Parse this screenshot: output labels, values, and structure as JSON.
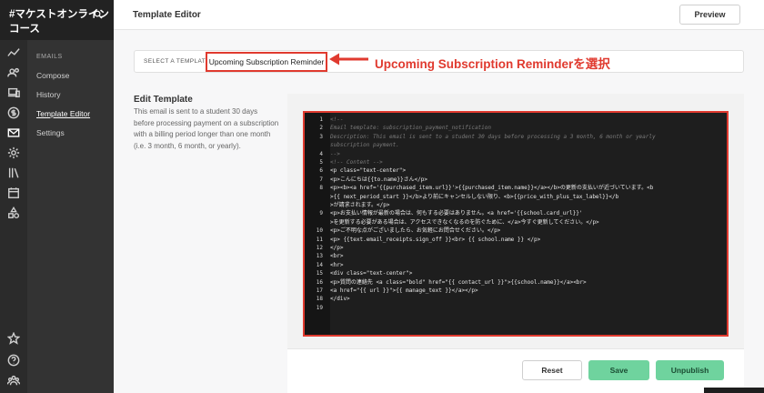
{
  "brand": {
    "name_line1": "#マケストオンライン",
    "name_line2": "コース"
  },
  "sidebar": {
    "section": "EMAILS",
    "items": [
      {
        "label": "Compose",
        "active": false
      },
      {
        "label": "History",
        "active": false
      },
      {
        "label": "Template Editor",
        "active": true
      },
      {
        "label": "Settings",
        "active": false
      }
    ]
  },
  "rail_icons": [
    "chart-icon",
    "users-icon",
    "devices-icon",
    "dollar-icon",
    "mail-icon",
    "settings-icon",
    "library-icon",
    "calendar-icon",
    "shapes-icon",
    "star-icon",
    "help-icon",
    "community-icon"
  ],
  "header": {
    "title": "Template Editor",
    "preview_label": "Preview"
  },
  "selector": {
    "label": "SELECT A TEMPLATE",
    "value": "Upcoming Subscription Reminder"
  },
  "annotation": {
    "callout": "Upcoming Subscription Reminderを選択",
    "color": "#e03a2f"
  },
  "edit": {
    "heading": "Edit Template",
    "description": "This email is sent to a student 30 days before processing payment on a subscription with a billing period longer than one month (i.e. 3 month, 6 month, or yearly)."
  },
  "code": [
    {
      "n": "1",
      "text": "<!--",
      "comment": true
    },
    {
      "n": "2",
      "text": "Email template: subscription_payment_notification",
      "comment": true
    },
    {
      "n": "3",
      "text": "Description: This email is sent to a student 30 days before processing a 3 month, 6 month or yearly",
      "comment": true
    },
    {
      "n": "",
      "text": "   subscription payment.",
      "comment": true
    },
    {
      "n": "4",
      "text": "-->",
      "comment": true
    },
    {
      "n": "5",
      "text": "<!-- Content -->",
      "comment": true
    },
    {
      "n": "6",
      "text": "<p class=\"text-center\">",
      "comment": false
    },
    {
      "n": "7",
      "text": "  <p>こんにちは{{to.name}}さん</p>",
      "comment": false
    },
    {
      "n": "8",
      "text": "  <p><b><a href='{{purchased_item.url}}'>{{purchased_item.name}}</a></b>の更新の支払いが近づいています。<b",
      "comment": false
    },
    {
      "n": "",
      "text": "    >{{ next_period_start }}</b>より前にキャンセルしない限り、<b>{{price_with_plus_tax_label}}</b",
      "comment": false
    },
    {
      "n": "",
      "text": "    >が請求されます。</p>",
      "comment": false
    },
    {
      "n": "9",
      "text": "  <p>お支払い情報が最新の場合は、何もする必要はありません。<a href='{{school.card_url}}'",
      "comment": false
    },
    {
      "n": "",
      "text": "    >を更新する必要がある場合は、アクセスできなくなるのを防ぐために、</a>今すぐ更新してください。</p>",
      "comment": false
    },
    {
      "n": "10",
      "text": "  <p>ご不明な点がございましたら、お気軽にお問合せください。</p>",
      "comment": false
    },
    {
      "n": "11",
      "text": "  <p> {{text.email_receipts.sign_off }}<br> {{ school.name }} </p>",
      "comment": false
    },
    {
      "n": "12",
      "text": "</p>",
      "comment": false
    },
    {
      "n": "13",
      "text": "<br>",
      "comment": false
    },
    {
      "n": "14",
      "text": "<hr>",
      "comment": false
    },
    {
      "n": "15",
      "text": "<div class=\"text-center\">",
      "comment": false
    },
    {
      "n": "16",
      "text": "  <p>質問の連絡先 <a class=\"bold\" href=\"{{ contact_url }}\">{{school.name}}</a><br>",
      "comment": false
    },
    {
      "n": "17",
      "text": "  <a href=\"{{ url }}\">{{ manage_text }}</a></p>",
      "comment": false
    },
    {
      "n": "18",
      "text": "</div>",
      "comment": false
    },
    {
      "n": "19",
      "text": "",
      "comment": false
    }
  ],
  "buttons": {
    "reset": "Reset",
    "save": "Save",
    "unpublish": "Unpublish"
  },
  "colors": {
    "accent_red": "#e03a2f",
    "save_green": "#6fd39e",
    "sidebar_dark": "#333333"
  }
}
